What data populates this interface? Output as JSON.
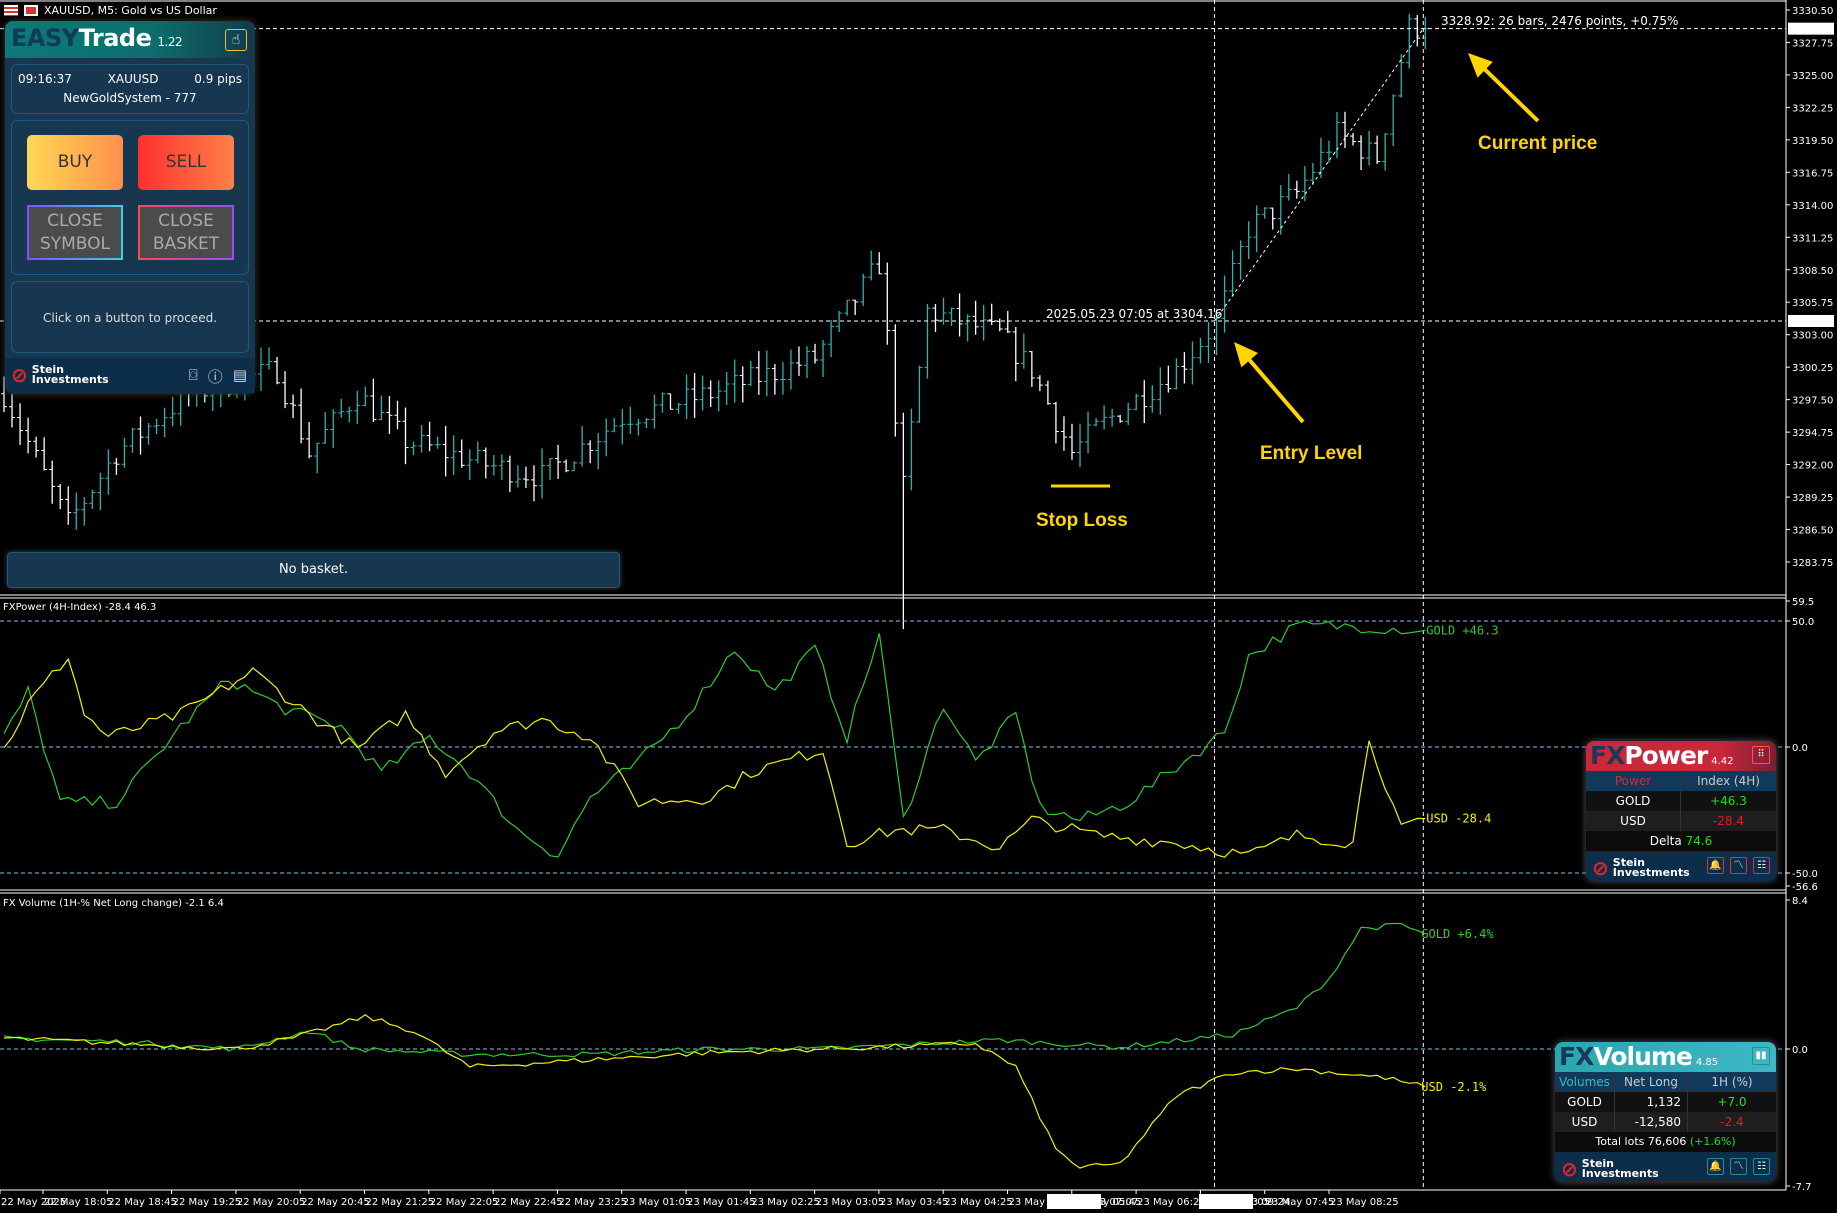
{
  "window": {
    "title": "XAUUSD, M5:  Gold vs US Dollar"
  },
  "easytrade": {
    "brand_a": "EASY",
    "brand_b": "Trade",
    "version": "1.22",
    "time": "09:16:37",
    "symbol": "XAUUSD",
    "spread": "0.9 pips",
    "system": "NewGoldSystem - 777",
    "buy": "BUY",
    "sell": "SELL",
    "close_symbol": "CLOSE SYMBOL",
    "close_basket": "CLOSE BASKET",
    "message": "Click on a button to proceed.",
    "footer_brand_1": "Stein",
    "footer_brand_2": "Investments"
  },
  "basket": {
    "status": "No basket."
  },
  "annotations": {
    "measure": "3328.92: 26 bars, 2476 points, +0.75%",
    "entry_point": "2025.05.23 07:05 at 3304.16",
    "current_price": "Current price",
    "entry_level": "Entry Level",
    "stop_loss": "Stop Loss",
    "color": "#ffd500"
  },
  "price_axis": {
    "labels": [
      "3330.50",
      "3327.75",
      "3325.00",
      "3322.25",
      "3319.50",
      "3316.75",
      "3314.00",
      "3311.25",
      "3308.50",
      "3305.75",
      "3303.00",
      "3300.25",
      "3297.50",
      "3294.75",
      "3292.00",
      "3289.25",
      "3286.50",
      "3283.75"
    ],
    "current": "3328.92",
    "entry": "3304.16",
    "range": [
      3283.75,
      3330.5
    ]
  },
  "time_axis": {
    "labels": [
      "22 May 2025",
      "22 May 18:05",
      "22 May 18:45",
      "22 May 19:25",
      "22 May 20:05",
      "22 May 20:45",
      "22 May 21:25",
      "22 May 22:05",
      "22 May 22:45",
      "22 May 23:25",
      "23 May 01:05",
      "23 May 01:45",
      "23 May 02:25",
      "23 May 03:05",
      "23 May 03:45",
      "23 May 04:25",
      "23 May 05:05",
      "23 May 05:45",
      "23 May 06:25",
      "23 May 07:05",
      "23 May 07:45",
      "23 May 08:25"
    ],
    "cursor_1": "2025.05.23 07:07",
    "cursor_2": "2025.05.23 09:24"
  },
  "price_series": {
    "bars": 178,
    "entry_bar": 151,
    "current_bar": 177,
    "keypoints": [
      [
        0,
        3298
      ],
      [
        8,
        3287
      ],
      [
        14,
        3293
      ],
      [
        23,
        3298
      ],
      [
        34,
        3300
      ],
      [
        38,
        3293
      ],
      [
        44,
        3298
      ],
      [
        50,
        3294
      ],
      [
        60,
        3292
      ],
      [
        67,
        3291
      ],
      [
        77,
        3296
      ],
      [
        88,
        3298
      ],
      [
        101,
        3301
      ],
      [
        109,
        3309
      ],
      [
        112,
        3290
      ],
      [
        115,
        3305
      ],
      [
        124,
        3303
      ],
      [
        128,
        3300
      ],
      [
        133,
        3293
      ],
      [
        136,
        3295
      ],
      [
        146,
        3300
      ],
      [
        151,
        3304
      ],
      [
        155,
        3312
      ],
      [
        161,
        3315
      ],
      [
        166,
        3320
      ],
      [
        171,
        3318
      ],
      [
        175,
        3329
      ],
      [
        177,
        3328.9
      ]
    ]
  },
  "fxpower_pane": {
    "title": "FXPower (4H-Index) -28.4 46.3",
    "axis": [
      "59.5",
      "50.0",
      "0.0",
      "-50.0",
      "-56.6"
    ],
    "gold_label": "GOLD +46.3",
    "usd_label": "USD -28.4",
    "gold": [
      [
        0,
        4
      ],
      [
        3,
        22
      ],
      [
        7,
        -22
      ],
      [
        14,
        -22
      ],
      [
        22,
        8
      ],
      [
        28,
        27
      ],
      [
        35,
        15
      ],
      [
        42,
        8
      ],
      [
        47,
        -10
      ],
      [
        53,
        4
      ],
      [
        58,
        -10
      ],
      [
        64,
        -33
      ],
      [
        69,
        -43
      ],
      [
        73,
        -20
      ],
      [
        79,
        -6
      ],
      [
        85,
        13
      ],
      [
        91,
        39
      ],
      [
        96,
        22
      ],
      [
        101,
        39
      ],
      [
        105,
        4
      ],
      [
        109,
        45
      ],
      [
        112,
        -29
      ],
      [
        117,
        17
      ],
      [
        121,
        -6
      ],
      [
        126,
        13
      ],
      [
        129,
        -24
      ],
      [
        134,
        -29
      ],
      [
        140,
        -22
      ],
      [
        146,
        -8
      ],
      [
        152,
        6
      ],
      [
        155,
        36
      ],
      [
        161,
        48
      ],
      [
        168,
        48
      ],
      [
        177,
        46.3
      ]
    ],
    "usd": [
      [
        0,
        -1
      ],
      [
        3,
        17
      ],
      [
        8,
        36
      ],
      [
        10,
        13
      ],
      [
        13,
        4
      ],
      [
        22,
        13
      ],
      [
        31,
        30
      ],
      [
        38,
        13
      ],
      [
        44,
        -1
      ],
      [
        50,
        13
      ],
      [
        55,
        -10
      ],
      [
        61,
        6
      ],
      [
        67,
        11
      ],
      [
        73,
        4
      ],
      [
        79,
        -22
      ],
      [
        88,
        -20
      ],
      [
        93,
        -10
      ],
      [
        102,
        -1
      ],
      [
        105,
        -38
      ],
      [
        111,
        -33
      ],
      [
        117,
        -33
      ],
      [
        124,
        -40
      ],
      [
        128,
        -29
      ],
      [
        136,
        -35
      ],
      [
        146,
        -38
      ],
      [
        155,
        -43
      ],
      [
        161,
        -35
      ],
      [
        168,
        -38
      ],
      [
        170,
        4
      ],
      [
        174,
        -33
      ],
      [
        177,
        -28.4
      ]
    ]
  },
  "fxvolume_pane": {
    "title": "FX Volume (1H-% Net Long change)  -2.1 6.4",
    "axis": [
      "8.4",
      "0.0",
      "-7.7"
    ],
    "gold_label": "GOLD +6.4%",
    "usd_label": "USD -2.1%",
    "gold": [
      [
        0,
        0.6
      ],
      [
        15,
        0.4
      ],
      [
        29,
        0
      ],
      [
        38,
        1
      ],
      [
        44,
        0
      ],
      [
        58,
        -0.3
      ],
      [
        73,
        -0.3
      ],
      [
        88,
        0
      ],
      [
        102,
        0
      ],
      [
        124,
        0.5
      ],
      [
        139,
        0.1
      ],
      [
        153,
        0.8
      ],
      [
        161,
        2.3
      ],
      [
        165,
        3.9
      ],
      [
        169,
        6.7
      ],
      [
        174,
        6.9
      ],
      [
        177,
        6.4
      ]
    ],
    "usd": [
      [
        0,
        0.6
      ],
      [
        15,
        0.3
      ],
      [
        29,
        0
      ],
      [
        36,
        0.6
      ],
      [
        45,
        1.8
      ],
      [
        51,
        1
      ],
      [
        58,
        -1
      ],
      [
        69,
        -0.7
      ],
      [
        88,
        -0.2
      ],
      [
        109,
        0.1
      ],
      [
        121,
        0.3
      ],
      [
        126,
        -1
      ],
      [
        131,
        -5.6
      ],
      [
        134,
        -6.6
      ],
      [
        139,
        -6.4
      ],
      [
        146,
        -2.6
      ],
      [
        153,
        -1.3
      ],
      [
        161,
        -1.1
      ],
      [
        172,
        -1.6
      ],
      [
        177,
        -2.1
      ]
    ]
  },
  "fxpower": {
    "brand_a": "FX",
    "brand_b": "Power",
    "version": "4.42",
    "col1": "Power",
    "col2": "Index (4H)",
    "rows": [
      {
        "name": "GOLD",
        "value": "+46.3"
      },
      {
        "name": "USD",
        "value": "-28.4"
      }
    ],
    "delta_label": "Delta",
    "delta": "74.6",
    "footer_1": "Stein",
    "footer_2": "Investments"
  },
  "fxvolume": {
    "brand_a": "FX",
    "brand_b": "Volume",
    "version": "4.85",
    "col1": "Volumes",
    "col2": "Net Long",
    "col3": "1H (%)",
    "rows": [
      {
        "name": "GOLD",
        "net": "1,132",
        "pct": "+7.0"
      },
      {
        "name": "USD",
        "net": "-12,580",
        "pct": "-2.4"
      }
    ],
    "total_label": "Total lots 76,606",
    "total_change": "(+1.6%)",
    "footer_1": "Stein",
    "footer_2": "Investments"
  },
  "colors": {
    "up": "#2fb3b0",
    "down": "#ffffff",
    "gold": "#2ecc2e",
    "usd": "#f2f200",
    "level": "#7cc4f0"
  }
}
